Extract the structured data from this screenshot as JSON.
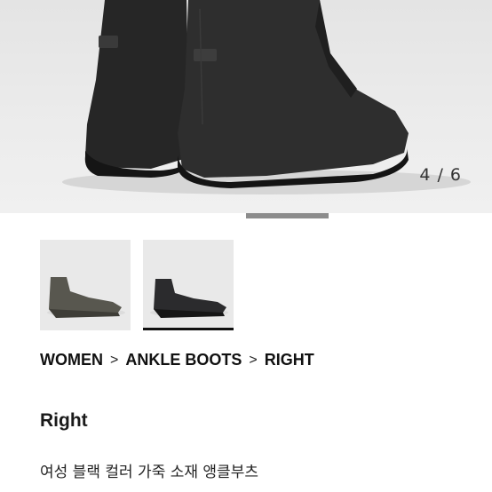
{
  "gallery": {
    "counter": "4 / 6",
    "current_image": 4,
    "total_images": 6,
    "progress_fraction_start": 0.5,
    "progress_fraction_end": 0.667,
    "background_color": "#ebebeb",
    "boot_color": "#2a2a2a"
  },
  "thumbnails": [
    {
      "color_name": "grey",
      "swatch": "#5a5a54",
      "selected": false
    },
    {
      "color_name": "black",
      "swatch": "#2c2c2e",
      "selected": true
    }
  ],
  "breadcrumb": {
    "items": [
      "WOMEN",
      "ANKLE BOOTS",
      "RIGHT"
    ],
    "separator": ">"
  },
  "product": {
    "name": "Right",
    "description": "여성 블랙 컬러 가죽 소재 앵클부츠"
  }
}
